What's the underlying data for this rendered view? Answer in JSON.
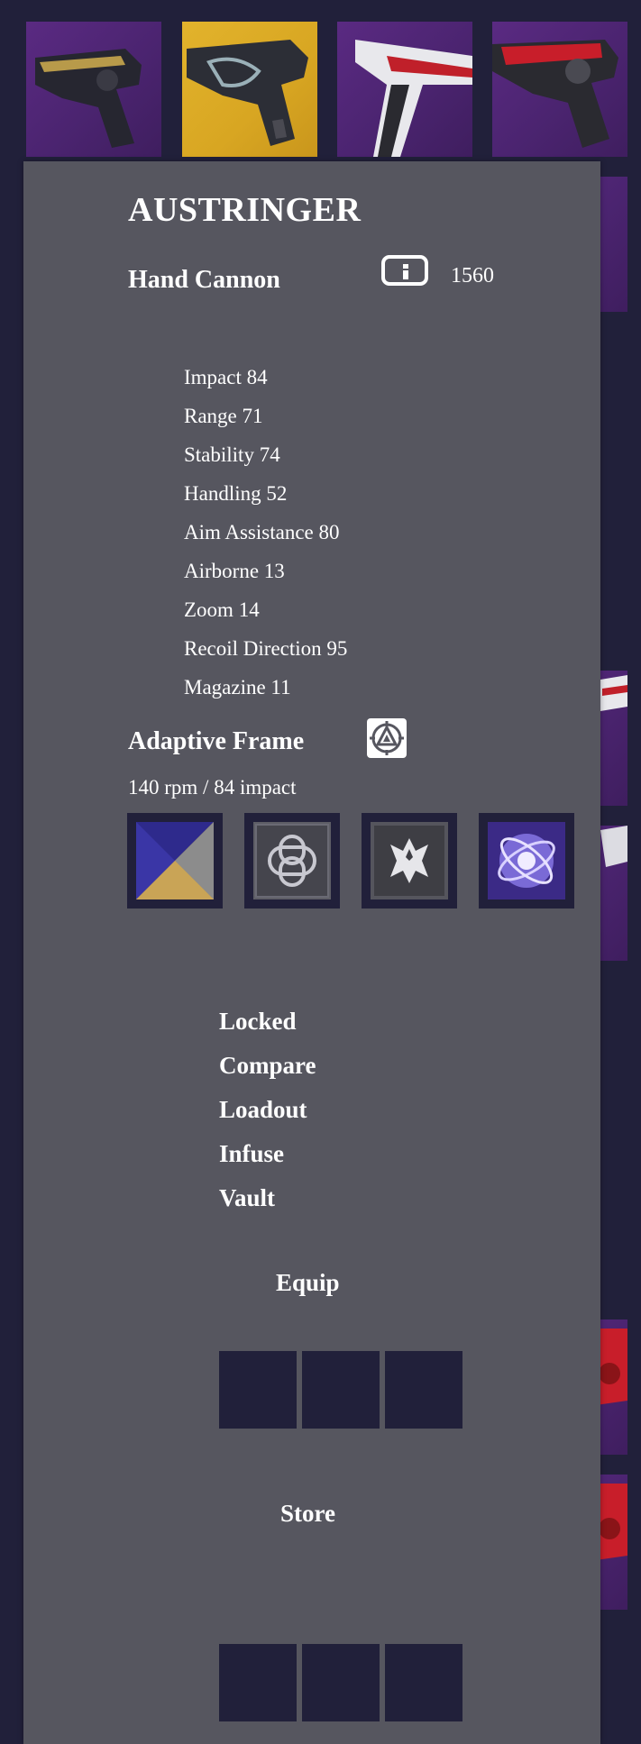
{
  "item": {
    "name": "AUSTRINGER",
    "type": "Hand Cannon",
    "power": "1560",
    "power_icon": "info-icon"
  },
  "stats": [
    {
      "label": "Impact 84"
    },
    {
      "label": "Range 71"
    },
    {
      "label": "Stability 74"
    },
    {
      "label": "Handling 52"
    },
    {
      "label": "Aim Assistance 80"
    },
    {
      "label": "Airborne 13"
    },
    {
      "label": "Zoom 14"
    },
    {
      "label": "Recoil Direction 95"
    },
    {
      "label": "Magazine 11"
    }
  ],
  "frame": {
    "name": "Adaptive Frame",
    "description": "140 rpm / 84 impact",
    "icon": "adaptive-frame-icon"
  },
  "perks": [
    {
      "icon": "barrel-perk-icon"
    },
    {
      "icon": "magazine-perk-icon"
    },
    {
      "icon": "trait-perk-icon"
    },
    {
      "icon": "masterwork-perk-icon"
    }
  ],
  "actions": [
    "Locked",
    "Compare",
    "Loadout",
    "Infuse",
    "Vault"
  ],
  "equip": {
    "label": "Equip",
    "slots": 3
  },
  "store": {
    "label": "Store",
    "slots": 3
  },
  "colors": {
    "background": "#21203a",
    "panel": "#56565f",
    "tile_purple": "#4b2470",
    "tile_gold": "#d8a622",
    "slot": "#21203a"
  }
}
